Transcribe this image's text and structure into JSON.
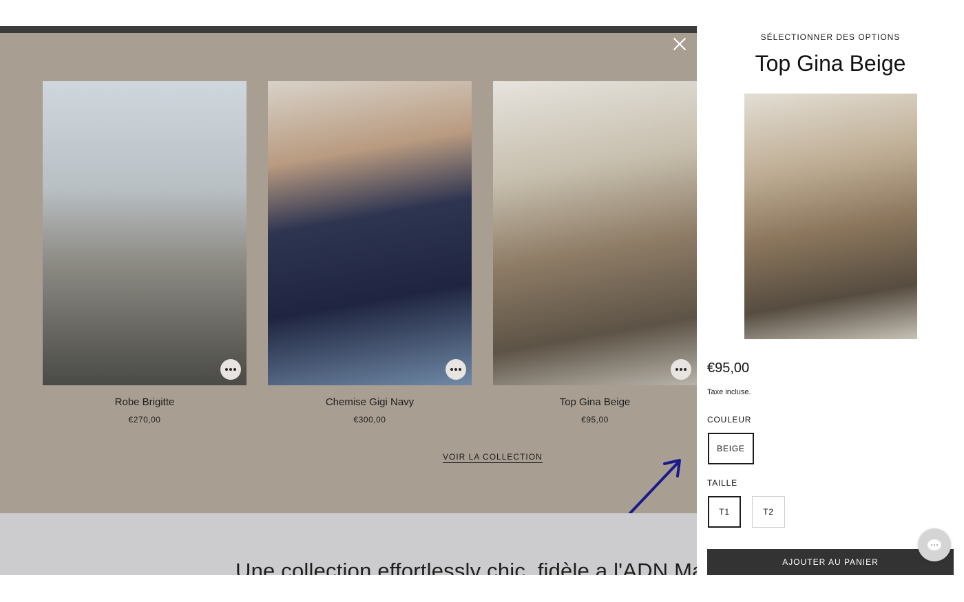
{
  "carousel": {
    "products": [
      {
        "name": "Robe Brigitte",
        "price": "€270,00"
      },
      {
        "name": "Chemise Gigi Navy",
        "price": "€300,00"
      },
      {
        "name": "Top Gina Beige",
        "price": "€95,00"
      }
    ],
    "view_collection_label": "VOIR LA COLLECTION"
  },
  "banner": {
    "heading": "Une collection effortlessly chic, fidèle a l'ADN Martin Ma"
  },
  "panel": {
    "kicker": "SÉLECTIONNER DES OPTIONS",
    "title": "Top Gina Beige",
    "price": "€95,00",
    "tax_note": "Taxe incluse.",
    "color_label": "COULEUR",
    "color_options": [
      "BEIGE"
    ],
    "size_label": "TAILLE",
    "size_options": [
      "T1",
      "T2"
    ],
    "add_to_cart_label": "AJOUTER AU PANIER"
  },
  "icons": {
    "close": "close-icon",
    "more": "more-options-icon",
    "chat": "chat-icon",
    "arrow": "annotation-arrow-icon"
  },
  "colors": {
    "overlay": "#a89e91",
    "panel_bg": "#ffffff",
    "primary_button": "#333333",
    "annotation_arrow": "#1a1a8c"
  }
}
